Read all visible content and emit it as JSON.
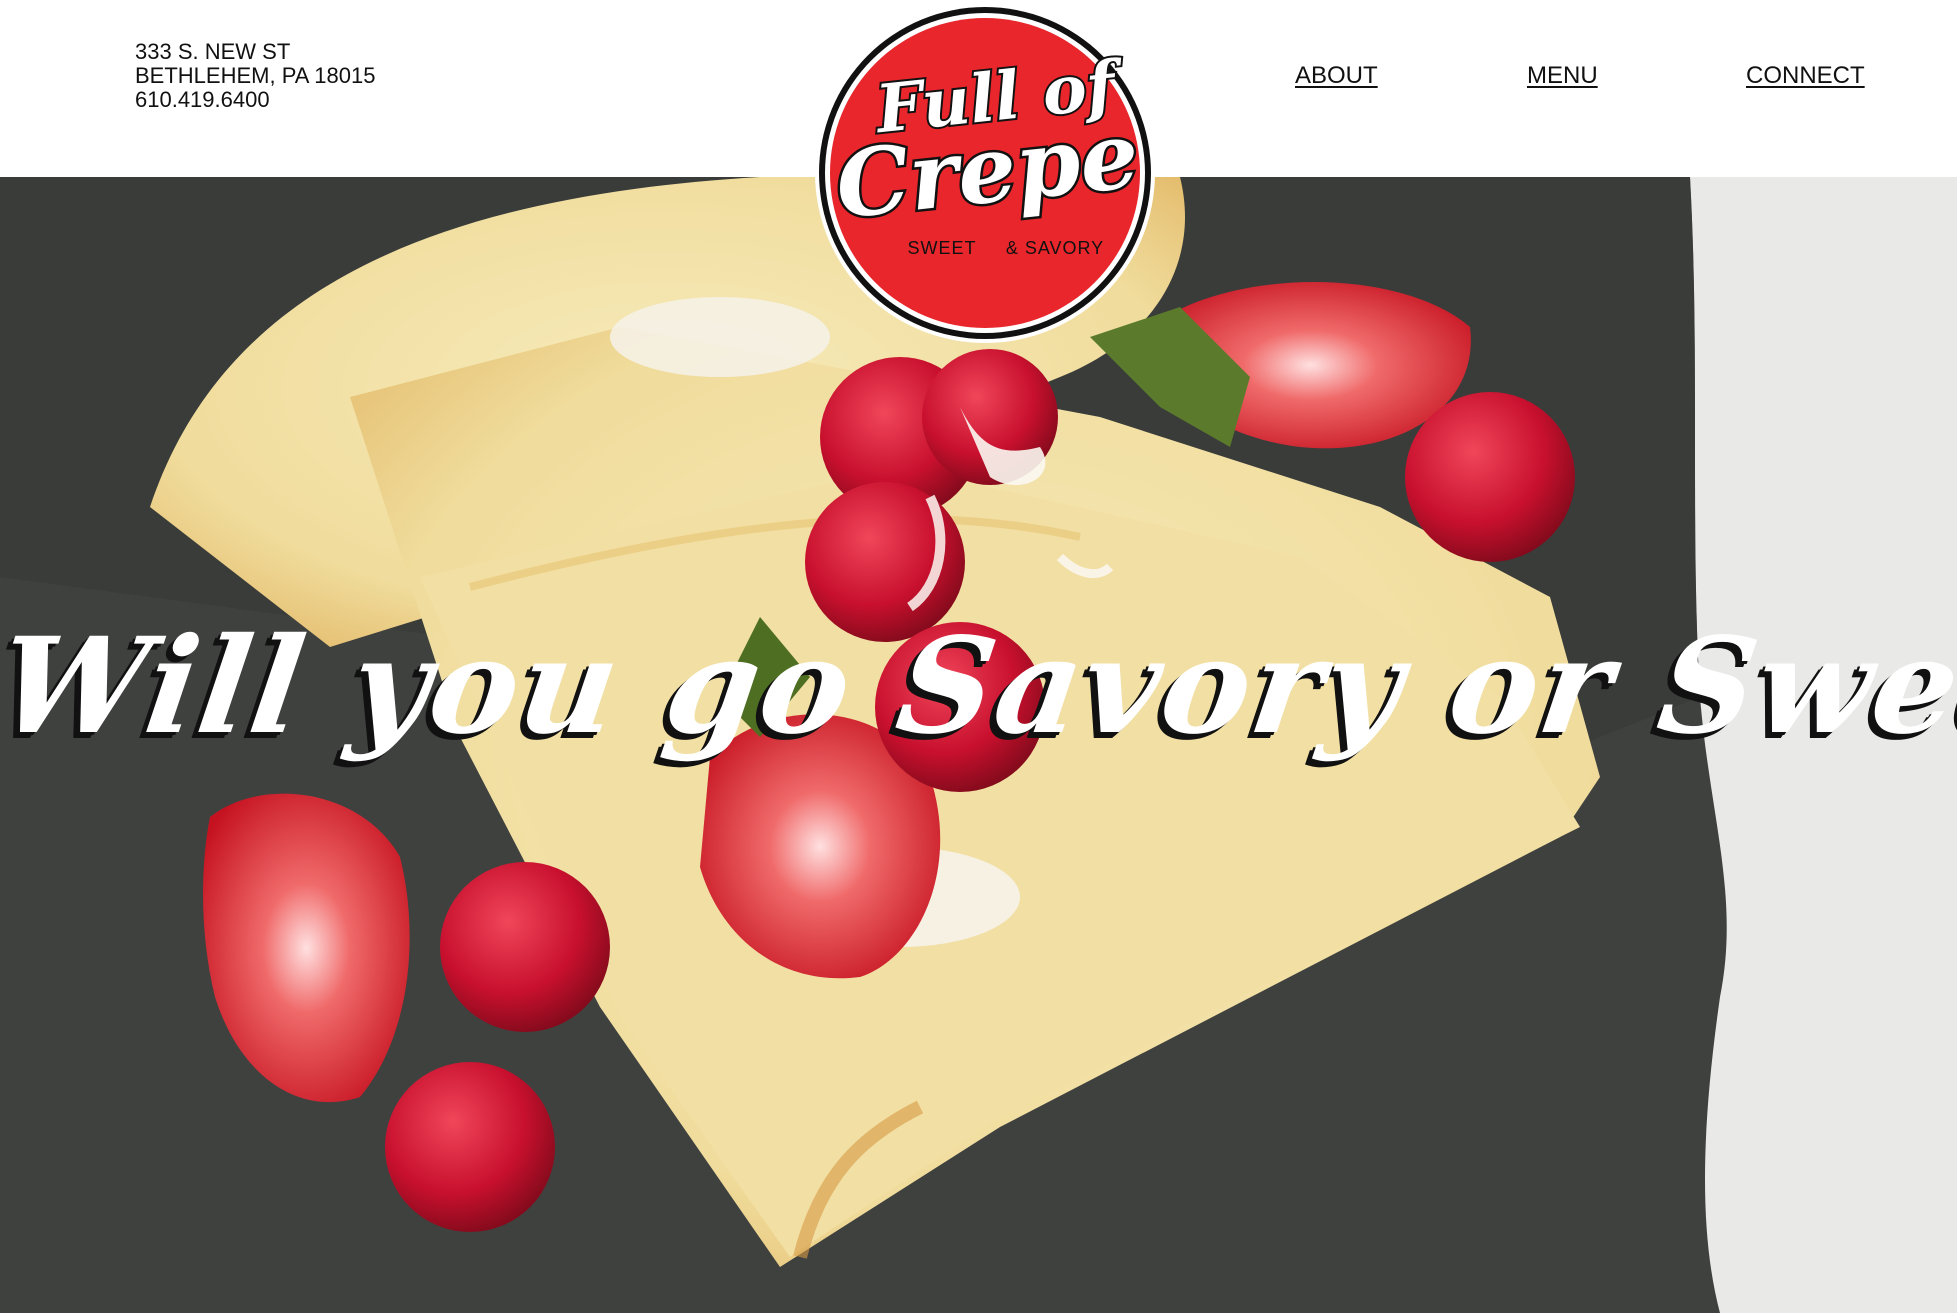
{
  "header": {
    "address": {
      "street": "333 S. NEW ST",
      "city": "BETHLEHEM, PA 18015",
      "phone": "610.419.6400"
    },
    "nav": [
      {
        "label": "ABOUT"
      },
      {
        "label": "MENU"
      },
      {
        "label": "CONNECT"
      }
    ]
  },
  "logo": {
    "line1": "Full of",
    "line2": "Crepe",
    "tag_left": "SWEET",
    "tag_right": "& SAVORY",
    "colors": {
      "fill": "#e8262b",
      "ring": "#111111",
      "text": "#ffffff"
    }
  },
  "hero": {
    "headline": "Will you go Savory or Sweet?",
    "image_subject": "crepe-with-strawberries-and-raspberries"
  },
  "colors": {
    "brand_red": "#e8262b",
    "text": "#111111",
    "plate": "#3d3f3d",
    "crepe": "#f3e2a8"
  }
}
